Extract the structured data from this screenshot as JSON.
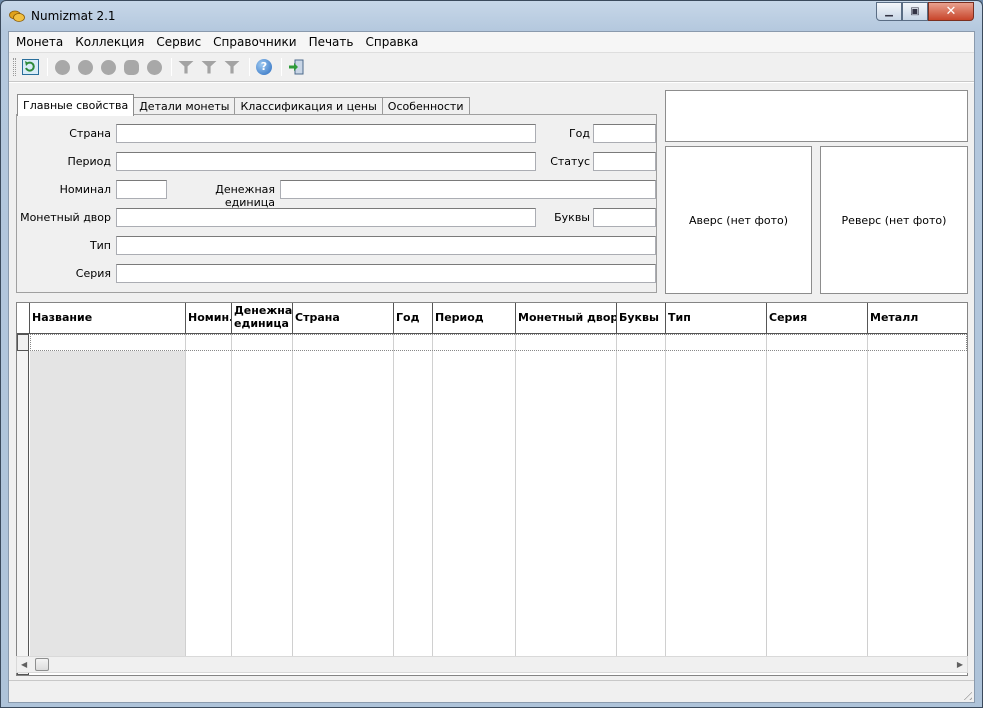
{
  "window": {
    "title": "Numizmat 2.1"
  },
  "menu": [
    "Монета",
    "Коллекция",
    "Сервис",
    "Справочники",
    "Печать",
    "Справка"
  ],
  "toolbar": {
    "icons": [
      "refresh-icon",
      "coin-icon",
      "coin-icon",
      "coin-icon",
      "coin-icon",
      "coin-icon",
      "funnel-icon",
      "funnel-icon",
      "funnel-icon",
      "help-icon",
      "exit-icon"
    ]
  },
  "tabs": [
    "Главные свойства",
    "Детали монеты",
    "Классификация и цены",
    "Особенности"
  ],
  "form": {
    "country": {
      "label": "Страна",
      "value": ""
    },
    "year": {
      "label": "Год",
      "value": ""
    },
    "period": {
      "label": "Период",
      "value": ""
    },
    "status": {
      "label": "Статус",
      "value": ""
    },
    "nominal": {
      "label": "Номинал",
      "value": ""
    },
    "currency": {
      "label": "Денежная единица",
      "value": ""
    },
    "mint": {
      "label": "Монетный двор",
      "value": ""
    },
    "letters": {
      "label": "Буквы",
      "value": ""
    },
    "type": {
      "label": "Тип",
      "value": ""
    },
    "series": {
      "label": "Серия",
      "value": ""
    }
  },
  "photos": {
    "obverse": "Аверс (нет фото)",
    "reverse": "Реверс (нет фото)"
  },
  "grid": {
    "columns": [
      "Название",
      "Номин.",
      "Денежная единица",
      "Страна",
      "Год",
      "Период",
      "Монетный двор",
      "Буквы",
      "Тип",
      "Серия",
      "Металл"
    ]
  }
}
